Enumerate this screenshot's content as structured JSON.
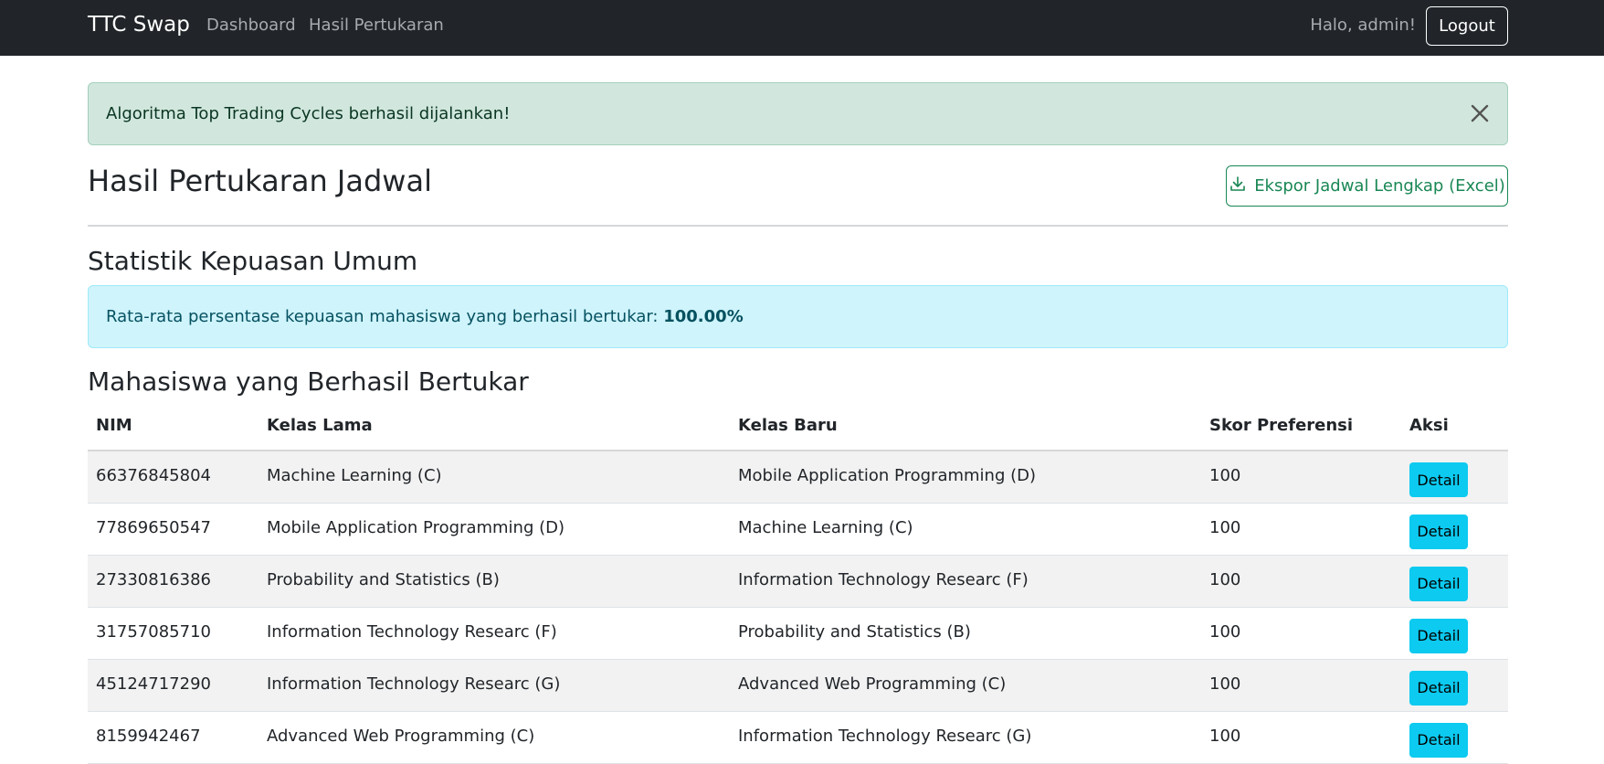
{
  "navbar": {
    "brand": "TTC Swap",
    "links": [
      "Dashboard",
      "Hasil Pertukaran"
    ],
    "greeting": "Halo, admin!",
    "logout_label": "Logout"
  },
  "alert_success": {
    "message": "Algoritma Top Trading Cycles berhasil dijalankan!"
  },
  "page": {
    "title": "Hasil Pertukaran Jadwal",
    "export_label": "Ekspor Jadwal Lengkap (Excel)"
  },
  "stats": {
    "title": "Statistik Kepuasan Umum",
    "message": "Rata-rata persentase kepuasan mahasiswa yang berhasil bertukar:",
    "value": "100.00%"
  },
  "swaps": {
    "title": "Mahasiswa yang Berhasil Bertukar",
    "columns": [
      "NIM",
      "Kelas Lama",
      "Kelas Baru",
      "Skor Preferensi",
      "Aksi"
    ],
    "detail_label": "Detail",
    "rows": [
      {
        "nim": "66376845804",
        "old": "Machine Learning (C)",
        "new": "Mobile Application Programming (D)",
        "score": "100"
      },
      {
        "nim": "77869650547",
        "old": "Mobile Application Programming (D)",
        "new": "Machine Learning (C)",
        "score": "100"
      },
      {
        "nim": "27330816386",
        "old": "Probability and Statistics (B)",
        "new": "Information Technology Researc (F)",
        "score": "100"
      },
      {
        "nim": "31757085710",
        "old": "Information Technology Researc (F)",
        "new": "Probability and Statistics (B)",
        "score": "100"
      },
      {
        "nim": "45124717290",
        "old": "Information Technology Researc (G)",
        "new": "Advanced Web Programming (C)",
        "score": "100"
      },
      {
        "nim": "8159942467",
        "old": "Advanced Web Programming (C)",
        "new": "Information Technology Researc (G)",
        "score": "100"
      }
    ]
  },
  "colors": {
    "navbar": "#212529",
    "success_bg": "#d1e7dd",
    "info_bg": "#cff4fc",
    "export_accent": "#198754",
    "detail_button": "#0dcaf0"
  },
  "icons": {
    "close": "close-icon",
    "download": "download-icon"
  }
}
